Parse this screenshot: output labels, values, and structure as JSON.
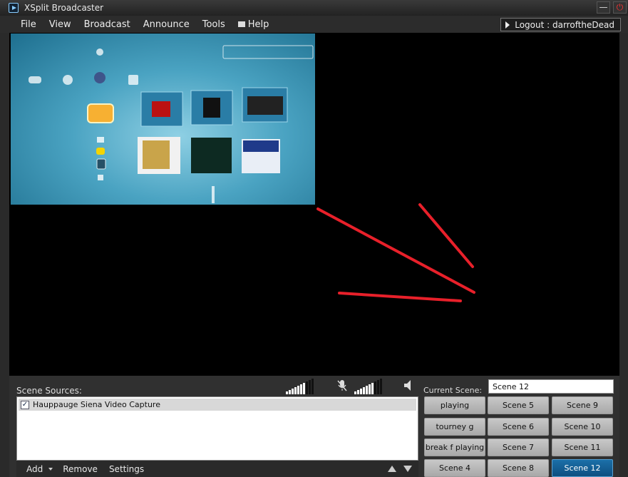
{
  "window": {
    "title": "XSplit Broadcaster",
    "min_label": "—",
    "close_label": "⏻"
  },
  "menu": [
    {
      "id": "file",
      "label": "File"
    },
    {
      "id": "view",
      "label": "View"
    },
    {
      "id": "broadcast",
      "label": "Broadcast"
    },
    {
      "id": "announce",
      "label": "Announce"
    },
    {
      "id": "tools",
      "label": "Tools"
    },
    {
      "id": "help",
      "label": "Help"
    }
  ],
  "logout": {
    "label": "Logout : darroftheDead"
  },
  "sources": {
    "label": "Scene Sources:",
    "items": [
      {
        "name": "Hauppauge Siena Video Capture",
        "checked": true
      }
    ],
    "toolbar": {
      "add": "Add",
      "remove": "Remove",
      "settings": "Settings"
    }
  },
  "current_scene": {
    "label": "Current Scene:",
    "value": "Scene 12"
  },
  "scenes": [
    [
      "playing",
      "Scene 5",
      "Scene 9"
    ],
    [
      "tourney g",
      "Scene 6",
      "Scene 10"
    ],
    [
      "break f playing",
      "Scene 7",
      "Scene 11"
    ],
    [
      "Scene 4",
      "Scene 8",
      "Scene 12"
    ]
  ],
  "active_scene": "Scene 12",
  "colors": {
    "accent": "#0e4f80",
    "annotation": "#e8202a",
    "meter": "#ffffff"
  }
}
